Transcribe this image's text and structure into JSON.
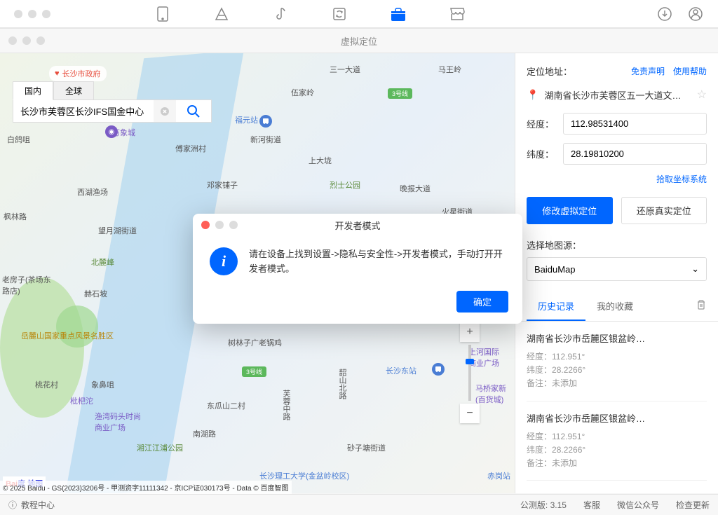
{
  "window": {
    "title": "虚拟定位"
  },
  "search": {
    "tab_domestic": "国内",
    "tab_global": "全球",
    "value": "长沙市芙蓉区长沙IFS国金中心"
  },
  "gov_badge": "长沙市政府",
  "map": {
    "labels": {
      "sanyi": "三一大道",
      "wanxiang": "万象城",
      "xinhe": "新河街道",
      "fujiazhoucun": "傅家洲村",
      "shangdadong": "上大垅",
      "dengjiapu": "邓家铺子",
      "lieshi": "烈士公园",
      "wanbao": "晚报大道",
      "huoxing": "火星街道",
      "wangyue": "望月湖街道",
      "fenglin": "枫林路",
      "xihuyu": "西湖渔场",
      "baige": "白鸽咀",
      "beilu": "北麓峰",
      "heshi": "赫石坡",
      "yuelu": "岳麓山国家重点风景名胜区",
      "taohua": "桃花村",
      "laofang": "老房子(茶场东路店)",
      "xiangbi": "象鼻咀",
      "pibatuo": "枇杷沱",
      "yuwan": "渔湾码头时尚商业广场",
      "xiangjiang": "湘江江浦公园",
      "donggua": "东瓜山二村",
      "nanhu": "南湖路",
      "furonglu": "芙蓉中路",
      "shaoshan": "韶山北路",
      "changshaeast": "长沙东站",
      "shulin": "树林子广老锅鸡",
      "shazi": "砂子塘街道",
      "wuyiling": "伍家岭",
      "changsha_ligong": "长沙理工大学(金盆岭校区)",
      "shanghe": "上河国际商业广场",
      "maqiao": "马桥家新(百货城)",
      "mawang": "马王岭",
      "chigang": "赤岗站",
      "fuyong": "福元站",
      "line3": "3号线"
    },
    "station_fuyong": "福"
  },
  "panel": {
    "title": "定位地址：",
    "link_disclaimer": "免责声明",
    "link_help": "使用帮助",
    "address": "湖南省长沙市芙蓉区五一大道文…",
    "lng_label": "经度：",
    "lng_value": "112.98531400",
    "lat_label": "纬度：",
    "lat_value": "28.19810200",
    "pickup_link": "拾取坐标系统",
    "btn_modify": "修改虚拟定位",
    "btn_restore": "还原真实定位",
    "mapsource_label": "选择地图源：",
    "mapsource_value": "BaiduMap",
    "tab_history": "历史记录",
    "tab_favorites": "我的收藏",
    "history": [
      {
        "title": "湖南省长沙市岳麓区银盆岭…",
        "lng_label": "经度：",
        "lng": "112.951°",
        "lat_label": "纬度：",
        "lat": "28.2266°",
        "note_label": "备注：",
        "note": "未添加"
      },
      {
        "title": "湖南省长沙市岳麓区银盆岭…",
        "lng_label": "经度：",
        "lng": "112.951°",
        "lat_label": "纬度：",
        "lat": "28.2266°",
        "note_label": "备注：",
        "note": "未添加"
      }
    ]
  },
  "dialog": {
    "title": "开发者模式",
    "message": "请在设备上找到设置->隐私与安全性->开发者模式，手动打开开发者模式。",
    "ok": "确定"
  },
  "copyright": "© 2025 Baidu - GS(2023)3206号 - 甲测资字11111342 - 京ICP证030173号 - Data © 百度智图",
  "baidu_logo": {
    "p1": "Bai",
    "p2": "地图"
  },
  "bottom": {
    "tutorial": "教程中心",
    "version": "公测版: 3.15",
    "service": "客服",
    "wechat": "微信公众号",
    "update": "检查更新"
  }
}
